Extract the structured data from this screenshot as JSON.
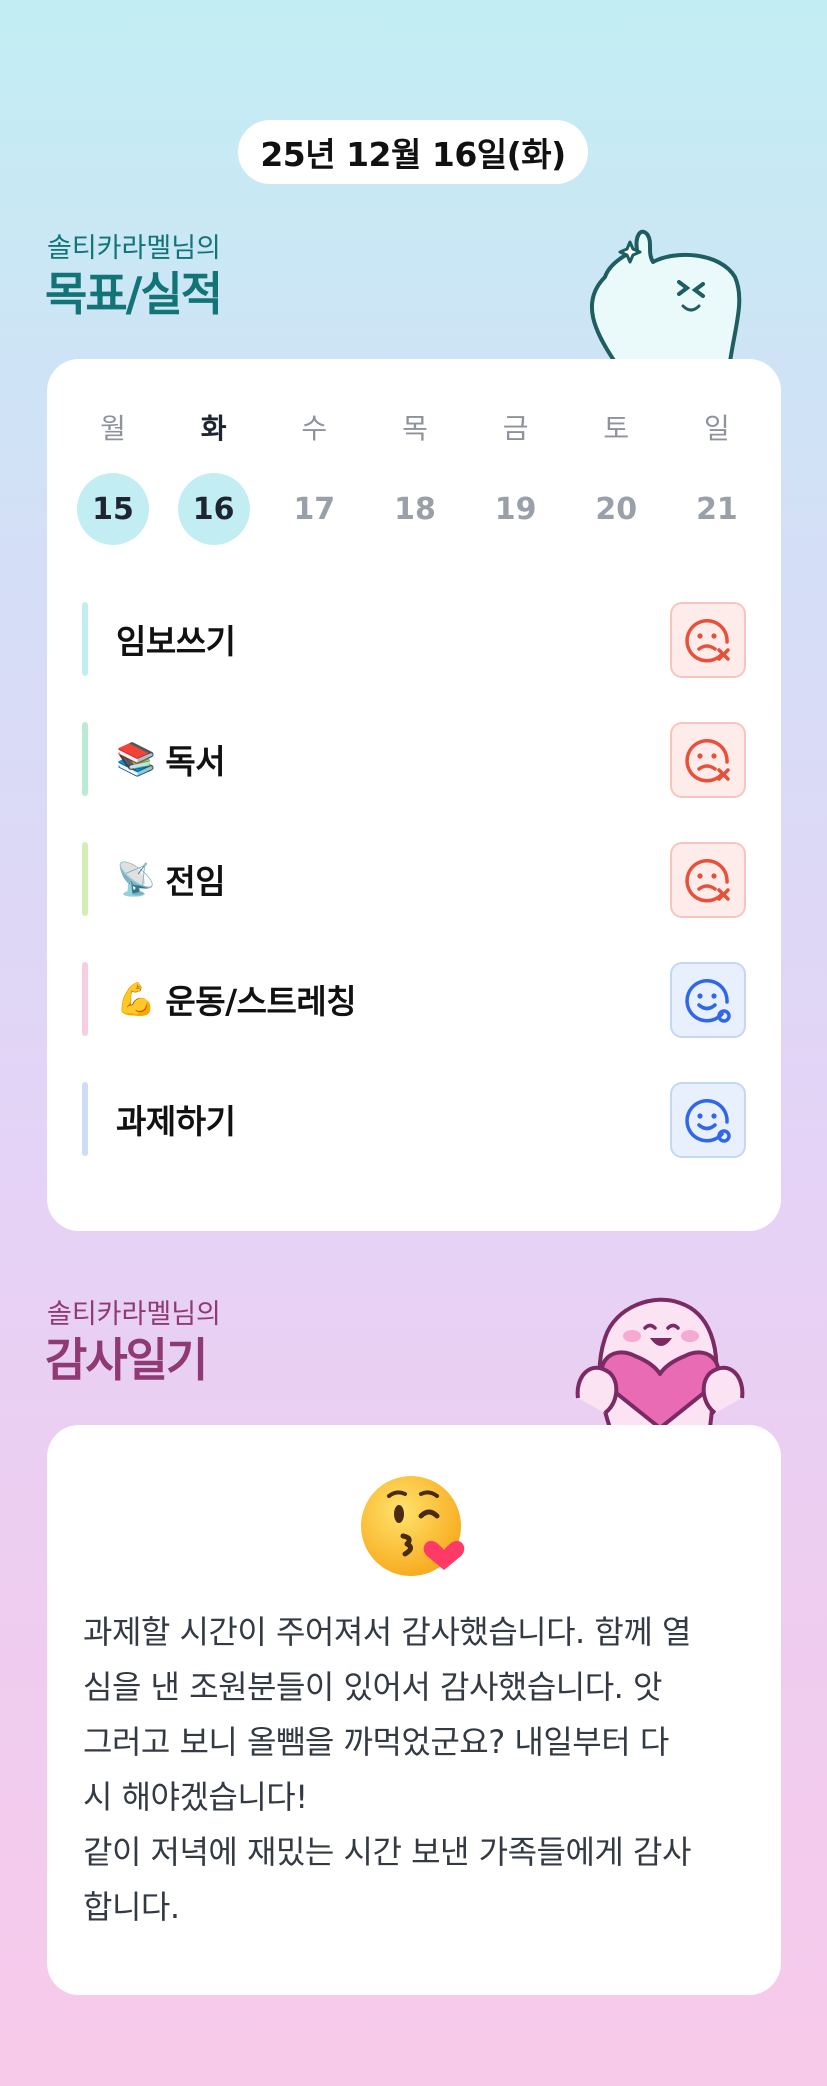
{
  "header": {
    "date": "25년 12월 16일(화)"
  },
  "goals_section": {
    "owner": "솔티카라멜님의",
    "title": "목표/실적"
  },
  "week": [
    {
      "label": "월",
      "num": "15",
      "active": true
    },
    {
      "label": "화",
      "num": "16",
      "active": true,
      "today": true
    },
    {
      "label": "수",
      "num": "17",
      "active": false
    },
    {
      "label": "목",
      "num": "18",
      "active": false
    },
    {
      "label": "금",
      "num": "19",
      "active": false
    },
    {
      "label": "토",
      "num": "20",
      "active": false
    },
    {
      "label": "일",
      "num": "21",
      "active": false
    }
  ],
  "goals": [
    {
      "emoji": "",
      "label": "임보쓰기",
      "status": "fail",
      "icon": "sad-face-x-icon",
      "bar_color": "#c2eef3"
    },
    {
      "emoji": "📚",
      "label": "독서",
      "status": "fail",
      "icon": "sad-face-x-icon",
      "bar_color": "#b9ead6"
    },
    {
      "emoji": "📡",
      "label": "전임",
      "status": "fail",
      "icon": "sad-face-x-icon",
      "bar_color": "#d4edb4"
    },
    {
      "emoji": "💪",
      "label": "운동/스트레칭",
      "status": "done",
      "icon": "smile-face-o-icon",
      "bar_color": "#f7cde3"
    },
    {
      "emoji": "",
      "label": "과제하기",
      "status": "done",
      "icon": "smile-face-o-icon",
      "bar_color": "#cfdcf7"
    }
  ],
  "colors": {
    "fail": "#e8503a",
    "done": "#2f67e8",
    "teal_title": "#137478",
    "plum_title": "#8f3a74"
  },
  "diary_section": {
    "owner": "솔티카라멜님의",
    "title": "감사일기"
  },
  "diary": {
    "emoji_icon": "kissing-face-icon",
    "text": "과제할 시간이 주어져서 감사했습니다. 함께 열\n심을 낸 조원분들이 있어서 감사했습니다. 앗\n그러고 보니 올뺌을 까먹었군요? 내일부터 다\n시 해야겠습니다!\n같이 저녁에 재밌는 시간 보낸 가족들에게 감사\n합니다."
  }
}
